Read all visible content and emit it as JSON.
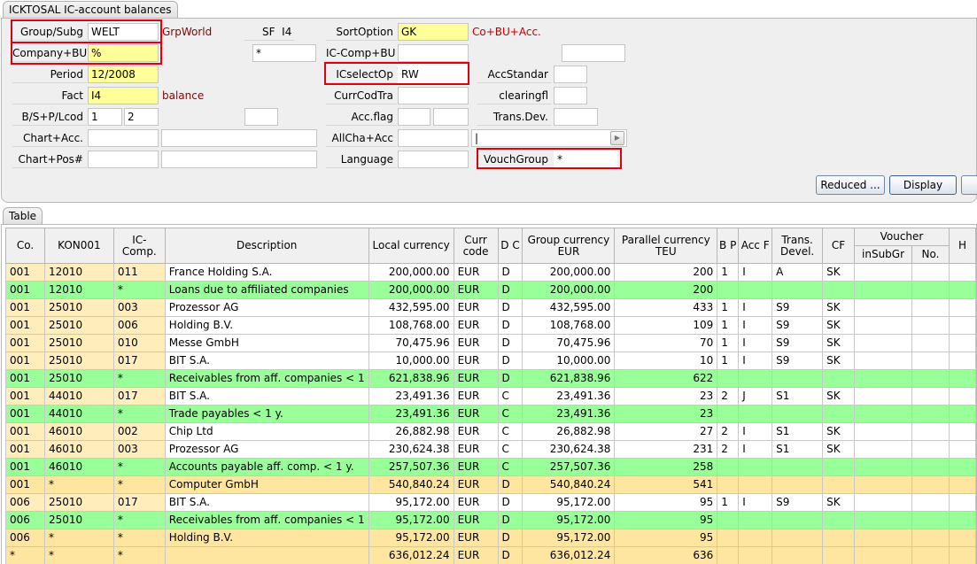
{
  "window": {
    "title": "ICKTOSAL IC-account balances"
  },
  "form": {
    "group_subg": {
      "label": "Group/Subg",
      "value": "WELT",
      "hint": "GrpWorld"
    },
    "company_bu": {
      "label": "Company+BU",
      "value": "%"
    },
    "period": {
      "label": "Period",
      "value": "12/2008"
    },
    "fact": {
      "label": "Fact",
      "value": "I4",
      "hint": "balance"
    },
    "bs_pl": {
      "label": "B/S+P/Lcod",
      "value1": "1",
      "value2": "2",
      "value3": ""
    },
    "chart_acc": {
      "label": "Chart+Acc.",
      "value1": "",
      "value2": ""
    },
    "chart_pos": {
      "label": "Chart+Pos#",
      "value1": "",
      "value2": ""
    },
    "sf": {
      "label": "SF",
      "value": "I4",
      "field": "*"
    },
    "sort_option": {
      "label": "SortOption",
      "value": "GK",
      "hint": "Co+BU+Acc."
    },
    "ic_comp_bu": {
      "label": "IC-Comp+BU",
      "value": "",
      "extra": ""
    },
    "icselect_op": {
      "label": "ICselectOp",
      "value": "RW"
    },
    "curr_cod_tra": {
      "label": "CurrCodTra",
      "value": ""
    },
    "acc_flag": {
      "label": "Acc.flag",
      "value1": "",
      "value2": ""
    },
    "allcha_acc": {
      "label": "AllCha+Acc",
      "value": "",
      "value2": "|"
    },
    "language": {
      "label": "Language",
      "value": ""
    },
    "acc_standar": {
      "label": "AccStandar",
      "value": ""
    },
    "clearingfl": {
      "label": "clearingfl",
      "value": ""
    },
    "trans_dev": {
      "label": "Trans.Dev.",
      "value": ""
    },
    "vouch_group": {
      "label": "VouchGroup",
      "value": "*"
    }
  },
  "buttons": {
    "reduced": "Reduced ...",
    "display": "Display"
  },
  "table": {
    "tab_label": "Table",
    "columns": {
      "co": "Co.",
      "kon": "KON001",
      "ic_comp": "IC-Comp.",
      "description": "Description",
      "local_currency": "Local currency",
      "curr_code": "Curr code",
      "dc": "D C",
      "group_currency": "Group currency EUR",
      "parallel_currency": "Parallel currency TEU",
      "bp": "B P",
      "acc_f": "Acc F",
      "trans_devel": "Trans. Devel.",
      "cf": "CF",
      "voucher": "Voucher",
      "in_sub_gr": "inSubGr",
      "no": "No.",
      "h": "H"
    },
    "rows": [
      {
        "type": "w",
        "co": "001",
        "kon": "12010",
        "ic": "011",
        "desc": "France Holding S.A.",
        "local": "200,000.00",
        "curr": "EUR",
        "dc": "D",
        "group": "200,000.00",
        "par": "200",
        "bp": "1",
        "accf": "I",
        "trans": "A",
        "cf": "SK"
      },
      {
        "type": "g",
        "co": "001",
        "kon": "12010",
        "ic": "*",
        "desc": "Loans due to affiliated companies",
        "local": "200,000.00",
        "curr": "EUR",
        "dc": "D",
        "group": "200,000.00",
        "par": "200",
        "bp": "",
        "accf": "",
        "trans": "",
        "cf": ""
      },
      {
        "type": "w",
        "co": "001",
        "kon": "25010",
        "ic": "003",
        "desc": "Prozessor AG",
        "local": "432,595.00",
        "curr": "EUR",
        "dc": "D",
        "group": "432,595.00",
        "par": "433",
        "bp": "1",
        "accf": "I",
        "trans": "S9",
        "cf": "SK"
      },
      {
        "type": "w",
        "co": "001",
        "kon": "25010",
        "ic": "006",
        "desc": "Holding B.V.",
        "local": "108,768.00",
        "curr": "EUR",
        "dc": "D",
        "group": "108,768.00",
        "par": "109",
        "bp": "1",
        "accf": "I",
        "trans": "S9",
        "cf": "SK"
      },
      {
        "type": "w",
        "co": "001",
        "kon": "25010",
        "ic": "010",
        "desc": "Messe GmbH",
        "local": "70,475.96",
        "curr": "EUR",
        "dc": "D",
        "group": "70,475.96",
        "par": "70",
        "bp": "1",
        "accf": "I",
        "trans": "S9",
        "cf": "SK"
      },
      {
        "type": "w",
        "co": "001",
        "kon": "25010",
        "ic": "017",
        "desc": "BIT S.A.",
        "local": "10,000.00",
        "curr": "EUR",
        "dc": "D",
        "group": "10,000.00",
        "par": "10",
        "bp": "1",
        "accf": "I",
        "trans": "S9",
        "cf": "SK"
      },
      {
        "type": "g",
        "co": "001",
        "kon": "25010",
        "ic": "*",
        "desc": "Receivables from aff. companies < 1",
        "local": "621,838.96",
        "curr": "EUR",
        "dc": "D",
        "group": "621,838.96",
        "par": "622",
        "bp": "",
        "accf": "",
        "trans": "",
        "cf": ""
      },
      {
        "type": "w",
        "co": "001",
        "kon": "44010",
        "ic": "017",
        "desc": "BIT S.A.",
        "local": "23,491.36",
        "curr": "EUR",
        "dc": "C",
        "group": "23,491.36",
        "par": "23",
        "bp": "2",
        "accf": "J",
        "trans": "S1",
        "cf": "SK"
      },
      {
        "type": "g",
        "co": "001",
        "kon": "44010",
        "ic": "*",
        "desc": "Trade payables < 1 y.",
        "local": "23,491.36",
        "curr": "EUR",
        "dc": "C",
        "group": "23,491.36",
        "par": "23",
        "bp": "",
        "accf": "",
        "trans": "",
        "cf": ""
      },
      {
        "type": "w",
        "co": "001",
        "kon": "46010",
        "ic": "002",
        "desc": "Chip Ltd",
        "local": "26,882.98",
        "curr": "EUR",
        "dc": "C",
        "group": "26,882.98",
        "par": "27",
        "bp": "2",
        "accf": "I",
        "trans": "S1",
        "cf": "SK"
      },
      {
        "type": "w",
        "co": "001",
        "kon": "46010",
        "ic": "003",
        "desc": "Prozessor AG",
        "local": "230,624.38",
        "curr": "EUR",
        "dc": "C",
        "group": "230,624.38",
        "par": "231",
        "bp": "2",
        "accf": "I",
        "trans": "S1",
        "cf": "SK"
      },
      {
        "type": "g",
        "co": "001",
        "kon": "46010",
        "ic": "*",
        "desc": "Accounts payable aff. comp. < 1 y.",
        "local": "257,507.36",
        "curr": "EUR",
        "dc": "C",
        "group": "257,507.36",
        "par": "258",
        "bp": "",
        "accf": "",
        "trans": "",
        "cf": ""
      },
      {
        "type": "t",
        "co": "001",
        "kon": "*",
        "ic": "*",
        "desc": "Computer GmbH",
        "local": "540,840.24",
        "curr": "EUR",
        "dc": "D",
        "group": "540,840.24",
        "par": "541",
        "bp": "",
        "accf": "",
        "trans": "",
        "cf": ""
      },
      {
        "type": "w",
        "co": "006",
        "kon": "25010",
        "ic": "017",
        "desc": "BIT S.A.",
        "local": "95,172.00",
        "curr": "EUR",
        "dc": "D",
        "group": "95,172.00",
        "par": "95",
        "bp": "1",
        "accf": "I",
        "trans": "S9",
        "cf": "SK"
      },
      {
        "type": "g",
        "co": "006",
        "kon": "25010",
        "ic": "*",
        "desc": "Receivables from aff. companies < 1",
        "local": "95,172.00",
        "curr": "EUR",
        "dc": "D",
        "group": "95,172.00",
        "par": "95",
        "bp": "",
        "accf": "",
        "trans": "",
        "cf": ""
      },
      {
        "type": "t",
        "co": "006",
        "kon": "*",
        "ic": "*",
        "desc": "Holding B.V.",
        "local": "95,172.00",
        "curr": "EUR",
        "dc": "D",
        "group": "95,172.00",
        "par": "95",
        "bp": "",
        "accf": "",
        "trans": "",
        "cf": ""
      },
      {
        "type": "t",
        "co": "*",
        "kon": "*",
        "ic": "*",
        "desc": "",
        "local": "636,012.24",
        "curr": "EUR",
        "dc": "D",
        "group": "636,012.24",
        "par": "636",
        "bp": "",
        "accf": "",
        "trans": "",
        "cf": ""
      }
    ]
  }
}
